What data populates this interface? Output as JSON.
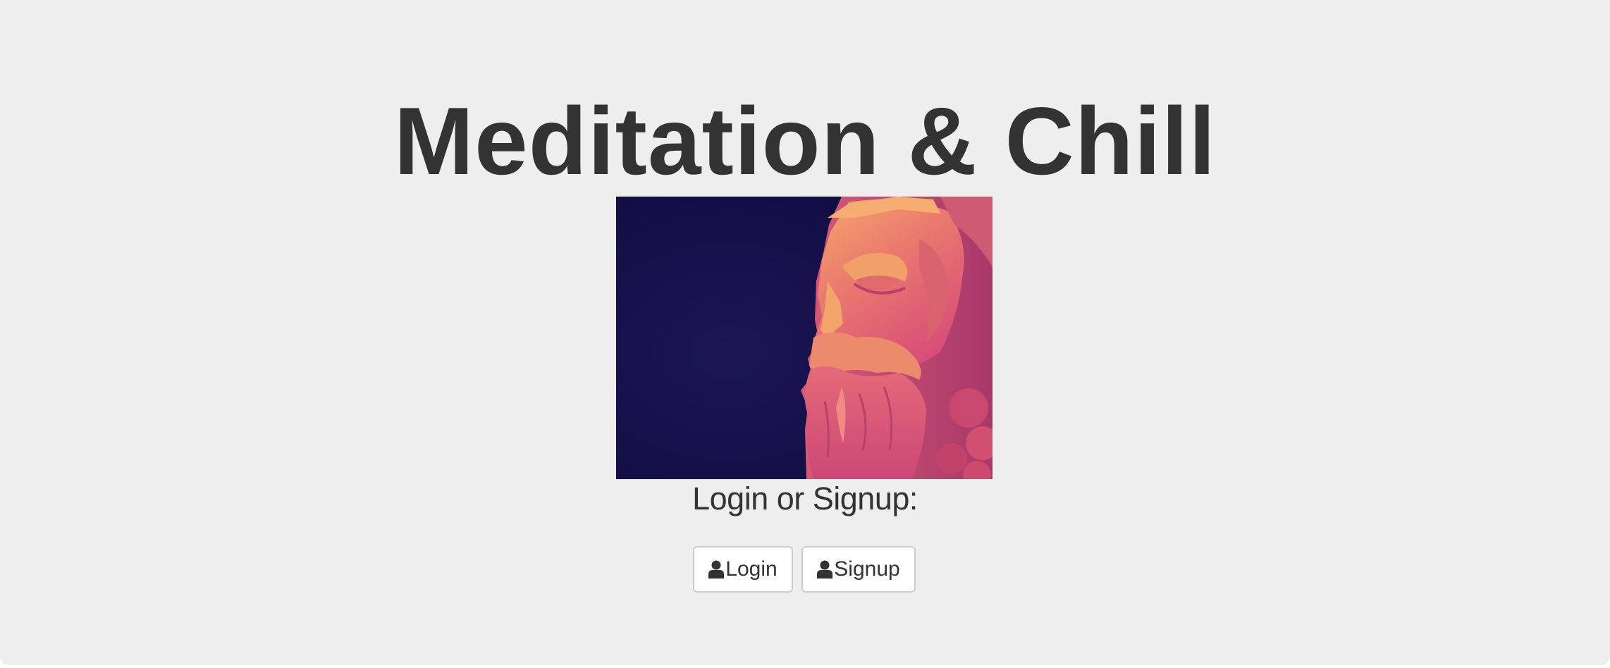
{
  "page": {
    "title": "Meditation & Chill",
    "subtitle": "Login or Signup:",
    "background_color": "#eeeeee",
    "text_color": "#333333"
  },
  "hero_image": {
    "description_icon": "sculpted-bearded-face-image",
    "colors": {
      "background": "#14104a",
      "face_highlight": "#f0a06a",
      "face_mid": "#dd5a78",
      "face_shadow": "#b03a66"
    }
  },
  "buttons": {
    "login": {
      "label": "Login",
      "icon": "user-icon"
    },
    "signup": {
      "label": "Signup",
      "icon": "user-icon"
    }
  }
}
